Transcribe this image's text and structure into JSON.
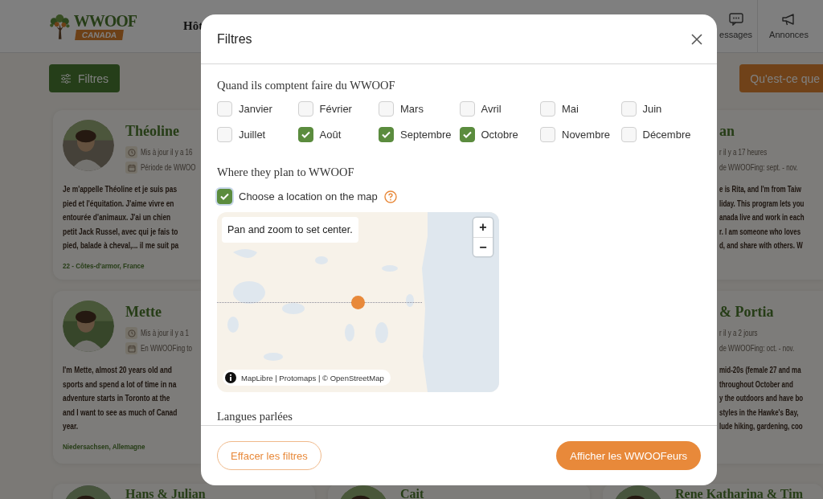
{
  "header": {
    "logo": {
      "title": "WWOOF",
      "subtitle": "CANADA"
    },
    "nav": [
      {
        "label": "Hôt",
        "kind": "text"
      },
      {
        "label": "essages",
        "kind": "messages"
      },
      {
        "label": "Annonces",
        "kind": "announcements"
      }
    ]
  },
  "toolbar": {
    "filter_button": "Filtres",
    "about_button": "Qu'est-ce que"
  },
  "cards": {
    "left": [
      {
        "name": "Théoline",
        "updated": "Mis à jour il y a 16",
        "period": "Période de WWOO",
        "description": [
          "Je m'appelle Théoline et je suis pas",
          "pied et l'équitation. J'aime vivre en",
          "entourée d'animaux. J'ai un chien",
          "petit Jack Russel, avec qui je fais to",
          "pied, balade à cheval,... il me suit pa"
        ],
        "location": "22 - Côtes-d'armor, France"
      },
      {
        "name": "Mette",
        "updated": "Mis à jour il y a 1",
        "period": "En WWOOFing to",
        "description": [
          "I'm Mette, almost 20 years old and",
          "sports and spend a lot of time in na",
          "adventure starts in Toronto at the",
          "and I want to see as much of Canad",
          "year."
        ],
        "location": "Niedersachsen, Allemagne"
      },
      {
        "name": "Hans & Julian"
      }
    ],
    "middle": [
      {
        "name": "Cait"
      }
    ],
    "right": [
      {
        "name": "an",
        "updated": "r il y a 17 heures",
        "period": "de WWOOFing: sept. - nov.",
        "description": [
          "e is Rita, and I'm from Taiw",
          "liday. This program lets you",
          "anada live and work in each",
          "r. I am someone who loves",
          "d, and share with others. W"
        ]
      },
      {
        "name": "& Portia",
        "updated": "r il y a 2 jours",
        "period": "de WWOOFing: oct. - nov.",
        "description": [
          "mid-20s (female 27 and ma",
          "throughout October and",
          "y the outdoors and have bo",
          "styles in the Hawke's Bay,",
          "lude hiking, gardening, coo"
        ]
      },
      {
        "name": "Rene Katharina & Tim"
      }
    ]
  },
  "modal": {
    "title": "Filtres",
    "when": {
      "heading": "Quand ils comptent faire du WWOOF",
      "months": [
        {
          "label": "Janvier",
          "checked": false
        },
        {
          "label": "Février",
          "checked": false
        },
        {
          "label": "Mars",
          "checked": false
        },
        {
          "label": "Avril",
          "checked": false
        },
        {
          "label": "Mai",
          "checked": false
        },
        {
          "label": "Juin",
          "checked": false
        },
        {
          "label": "Juillet",
          "checked": false
        },
        {
          "label": "Août",
          "checked": true
        },
        {
          "label": "Septembre",
          "checked": true
        },
        {
          "label": "Octobre",
          "checked": true
        },
        {
          "label": "Novembre",
          "checked": false
        },
        {
          "label": "Décembre",
          "checked": false
        }
      ]
    },
    "where": {
      "heading": "Where they plan to WWOOF",
      "option": {
        "label": "Choose a location on the map",
        "checked": true
      },
      "map": {
        "hint": "Pan and zoom to set center.",
        "zoom_in": "+",
        "zoom_out": "−",
        "attribution": "MapLibre | Protomaps | © OpenStreetMap"
      }
    },
    "languages": {
      "heading": "Langues parlées"
    },
    "clear_button": "Effacer les filtres",
    "show_button": "Afficher les WWOOFeurs"
  }
}
